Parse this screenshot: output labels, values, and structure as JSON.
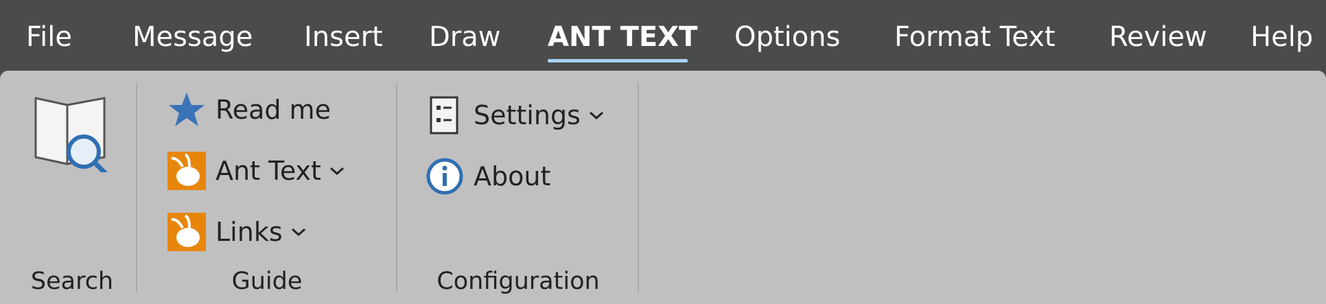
{
  "tabs": [
    {
      "label": "File"
    },
    {
      "label": "Message"
    },
    {
      "label": "Insert"
    },
    {
      "label": "Draw"
    },
    {
      "label": "ANT TEXT",
      "active": true
    },
    {
      "label": "Options"
    },
    {
      "label": "Format Text"
    },
    {
      "label": "Review"
    },
    {
      "label": "Help"
    }
  ],
  "groups": {
    "search": {
      "label": "Search",
      "icon": "book-search-icon"
    },
    "guide": {
      "label": "Guide",
      "items": [
        {
          "label": "Read me",
          "icon": "star-icon"
        },
        {
          "label": "Ant Text",
          "icon": "ant-text-icon",
          "dropdown": true
        },
        {
          "label": "Links",
          "icon": "ant-links-icon",
          "dropdown": true
        }
      ]
    },
    "configuration": {
      "label": "Configuration",
      "items": [
        {
          "label": "Settings",
          "icon": "settings-list-icon",
          "dropdown": true
        },
        {
          "label": "About",
          "icon": "info-icon"
        }
      ]
    }
  },
  "colors": {
    "tabbar_bg": "#4a4b4b",
    "ribbon_bg": "#c0c0c0",
    "accent": "#a9d3f5",
    "icon_orange": "#e8860b",
    "icon_blue": "#2f6fb3"
  }
}
